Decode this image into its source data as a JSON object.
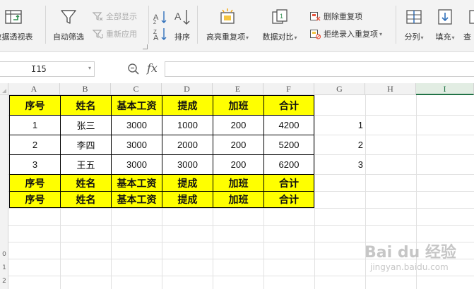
{
  "ribbon": {
    "pivot_label": "数据透视表",
    "autofilter_label": "自动筛选",
    "show_all_label": "全部显示",
    "reapply_label": "重新应用",
    "sort_label": "排序",
    "highlight_dup_label": "高亮重复项",
    "data_compare_label": "数据对比",
    "remove_dup_label": "删除重复项",
    "reject_dup_label": "拒绝录入重复项",
    "split_label": "分列",
    "fill_label": "填充",
    "find_label": "查"
  },
  "formula_bar": {
    "cell_ref": "I15",
    "fx_label": "fx",
    "formula": ""
  },
  "sheet": {
    "columns": [
      "A",
      "B",
      "C",
      "D",
      "E",
      "F",
      "G",
      "H",
      "I"
    ],
    "selected_column": "I",
    "row_labels": [
      "0",
      "1",
      "2"
    ],
    "header": [
      "序号",
      "姓名",
      "基本工资",
      "提成",
      "加班",
      "合计"
    ],
    "rows": [
      [
        "1",
        "张三",
        "3000",
        "1000",
        "200",
        "4200"
      ],
      [
        "2",
        "李四",
        "3000",
        "2000",
        "200",
        "5200"
      ],
      [
        "3",
        "王五",
        "3000",
        "3000",
        "200",
        "6200"
      ]
    ],
    "g_values": [
      "1",
      "2",
      "3"
    ]
  },
  "watermark": {
    "text": "Bai du 经验",
    "url": "jingyan.baidu.com"
  },
  "colors": {
    "header_fill": "#ffff00",
    "accent": "#217346"
  }
}
